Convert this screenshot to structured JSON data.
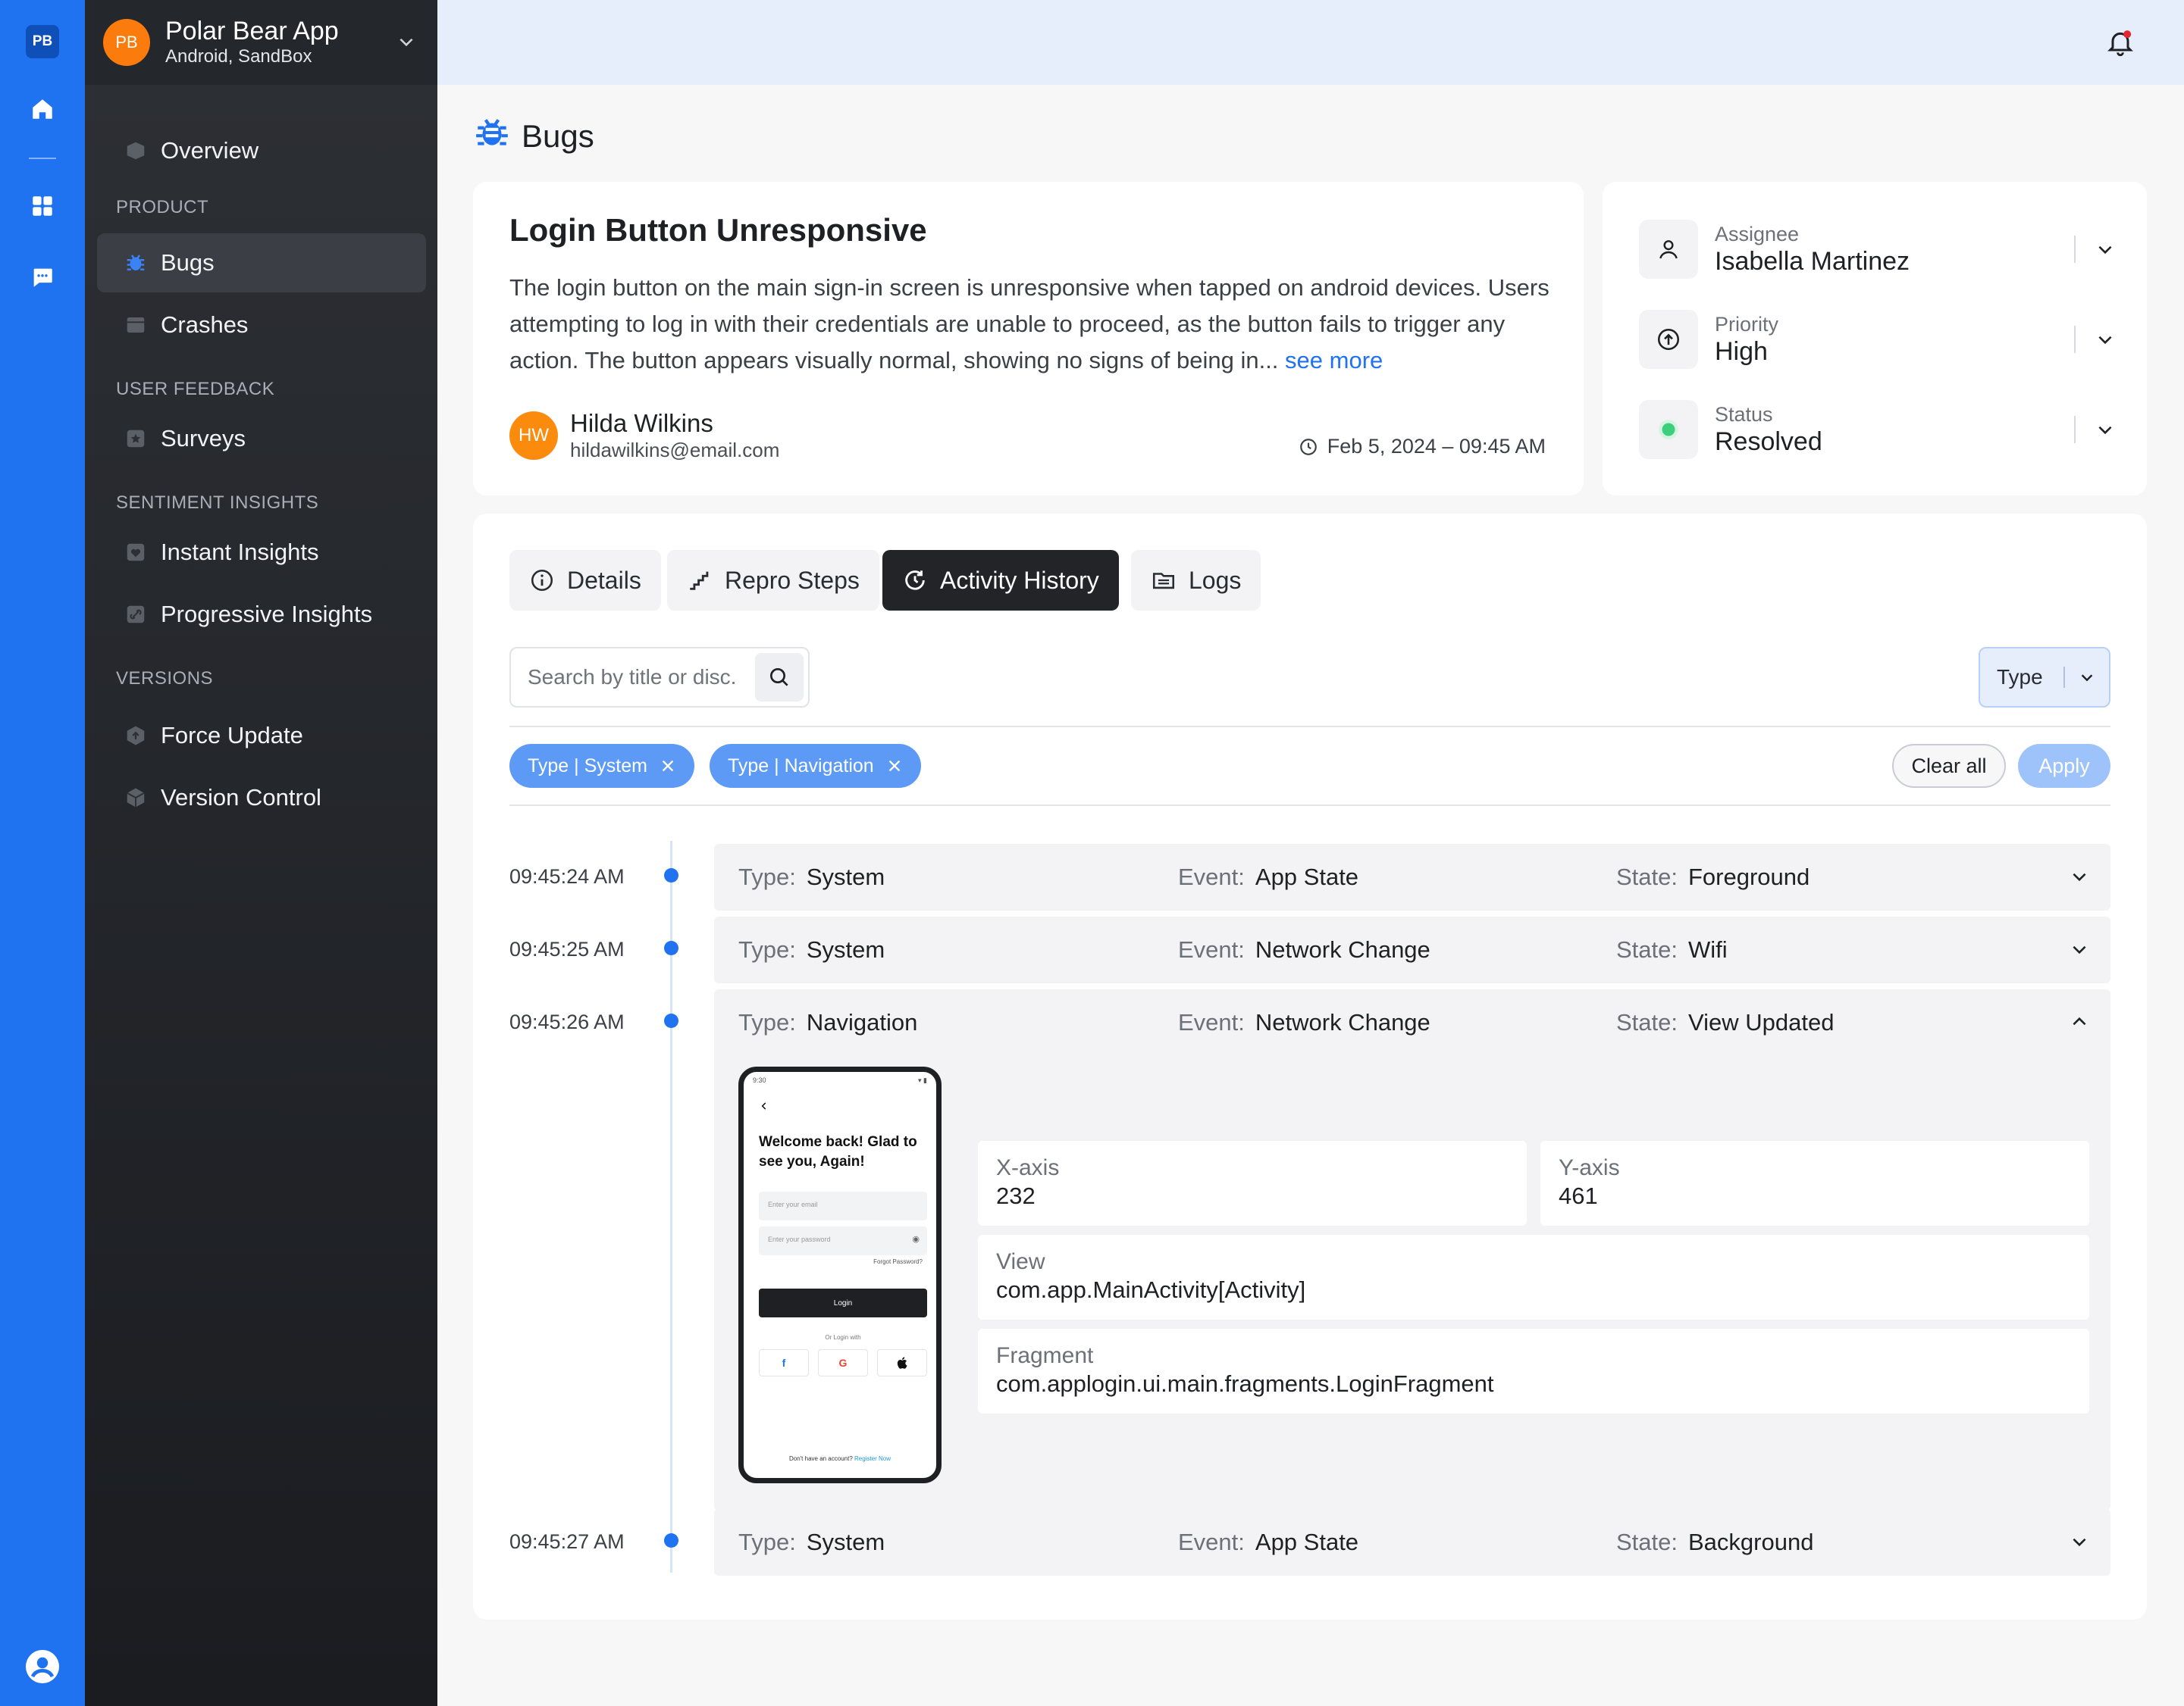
{
  "rail": {
    "badge": "PB"
  },
  "sidebar": {
    "app_avatar": "PB",
    "app_name": "Polar Bear App",
    "app_env": "Android, SandBox",
    "overview": "Overview",
    "sections": {
      "product": "PRODUCT",
      "user_feedback": "USER FEEDBACK",
      "sentiment": "SENTIMENT INSIGHTS",
      "versions": "VERSIONS"
    },
    "items": {
      "bugs": "Bugs",
      "crashes": "Crashes",
      "surveys": "Surveys",
      "instant": "Instant Insights",
      "progressive": "Progressive Insights",
      "force_update": "Force Update",
      "version_control": "Version Control"
    }
  },
  "page": {
    "title": "Bugs"
  },
  "bug": {
    "title": "Login Button Unresponsive",
    "description": "The login button on the main sign-in screen is unresponsive when tapped on android devices. Users attempting to log in with their credentials are unable to proceed, as the button fails to trigger any action. The button appears visually normal, showing no signs of being in...",
    "see_more": "see more",
    "reporter_initials": "HW",
    "reporter_name": "Hilda Wilkins",
    "reporter_email": "hildawilkins@email.com",
    "date": "Feb 5, 2024 – 09:45 AM"
  },
  "meta": {
    "assignee_label": "Assignee",
    "assignee_value": "Isabella Martinez",
    "priority_label": "Priority",
    "priority_value": "High",
    "status_label": "Status",
    "status_value": "Resolved",
    "status_color": "#3ecf7c"
  },
  "tabs": {
    "details": "Details",
    "repro": "Repro Steps",
    "activity": "Activity History",
    "logs": "Logs"
  },
  "filters": {
    "search_placeholder": "Search by title or disc.",
    "type_select": "Type",
    "chips": [
      "Type | System",
      "Type | Navigation"
    ],
    "clear_all": "Clear all",
    "apply": "Apply"
  },
  "labels": {
    "type": "Type:",
    "event": "Event:",
    "state": "State:"
  },
  "events": [
    {
      "time": "09:45:24 AM",
      "type": "System",
      "event": "App State",
      "state": "Foreground"
    },
    {
      "time": "09:45:25 AM",
      "type": "System",
      "event": "Network Change",
      "state": "Wifi"
    },
    {
      "time": "09:45:26 AM",
      "type": "Navigation",
      "event": "Network Change",
      "state": "View Updated"
    },
    {
      "time": "09:45:27 AM",
      "type": "System",
      "event": "App State",
      "state": "Background"
    }
  ],
  "detail": {
    "x_label": "X-axis",
    "x_value": "232",
    "y_label": "Y-axis",
    "y_value": "461",
    "view_label": "View",
    "view_value": "com.app.MainActivity[Activity]",
    "fragment_label": "Fragment",
    "fragment_value": "com.applogin.ui.main.fragments.LoginFragment"
  },
  "phone": {
    "time": "9:30",
    "title": "Welcome back! Glad to see you, Again!",
    "email_placeholder": "Enter your email",
    "password_placeholder": "Enter your password",
    "forgot": "Forgot Password?",
    "login": "Login",
    "or": "Or Login with",
    "social": [
      "f",
      "G",
      ""
    ],
    "footer": "Don't have an account?",
    "register": "Register Now"
  }
}
